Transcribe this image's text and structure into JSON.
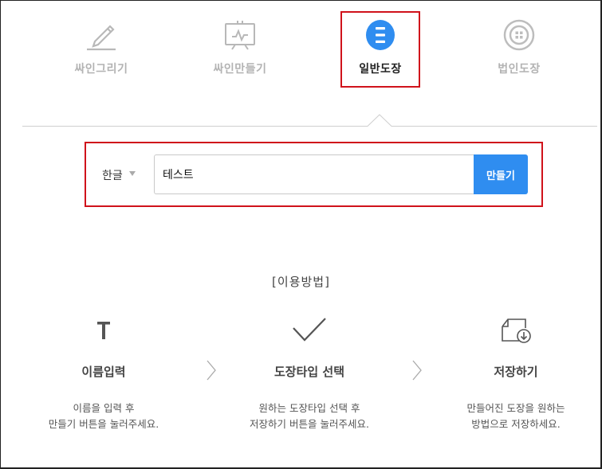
{
  "tabs": [
    {
      "label": "싸인그리기",
      "icon": "pen-sign-icon",
      "active": false
    },
    {
      "label": "싸인만들기",
      "icon": "sign-board-icon",
      "active": false
    },
    {
      "label": "일반도장",
      "icon": "stamp-icon",
      "active": true
    },
    {
      "label": "법인도장",
      "icon": "corporate-seal-icon",
      "active": false
    }
  ],
  "form": {
    "language": "한글",
    "input_value": "테스트",
    "submit_label": "만들기"
  },
  "usage": {
    "title": "[이용방법]",
    "steps": [
      {
        "icon": "text-t-icon",
        "title": "이름입력",
        "line1": "이름을 입력 후",
        "line2": "만들기 버튼을 눌러주세요."
      },
      {
        "icon": "checkmark-icon",
        "title": "도장타입 선택",
        "line1": "원하는 도장타입 선택 후",
        "line2": "저장하기 버튼을 눌러주세요."
      },
      {
        "icon": "save-file-icon",
        "title": "저장하기",
        "line1": "만들어진 도장을 원하는",
        "line2": "방법으로 저장하세요."
      }
    ]
  },
  "colors": {
    "accent": "#2f8df0",
    "highlight": "#d0121b",
    "inactive": "#b3b3b3"
  }
}
